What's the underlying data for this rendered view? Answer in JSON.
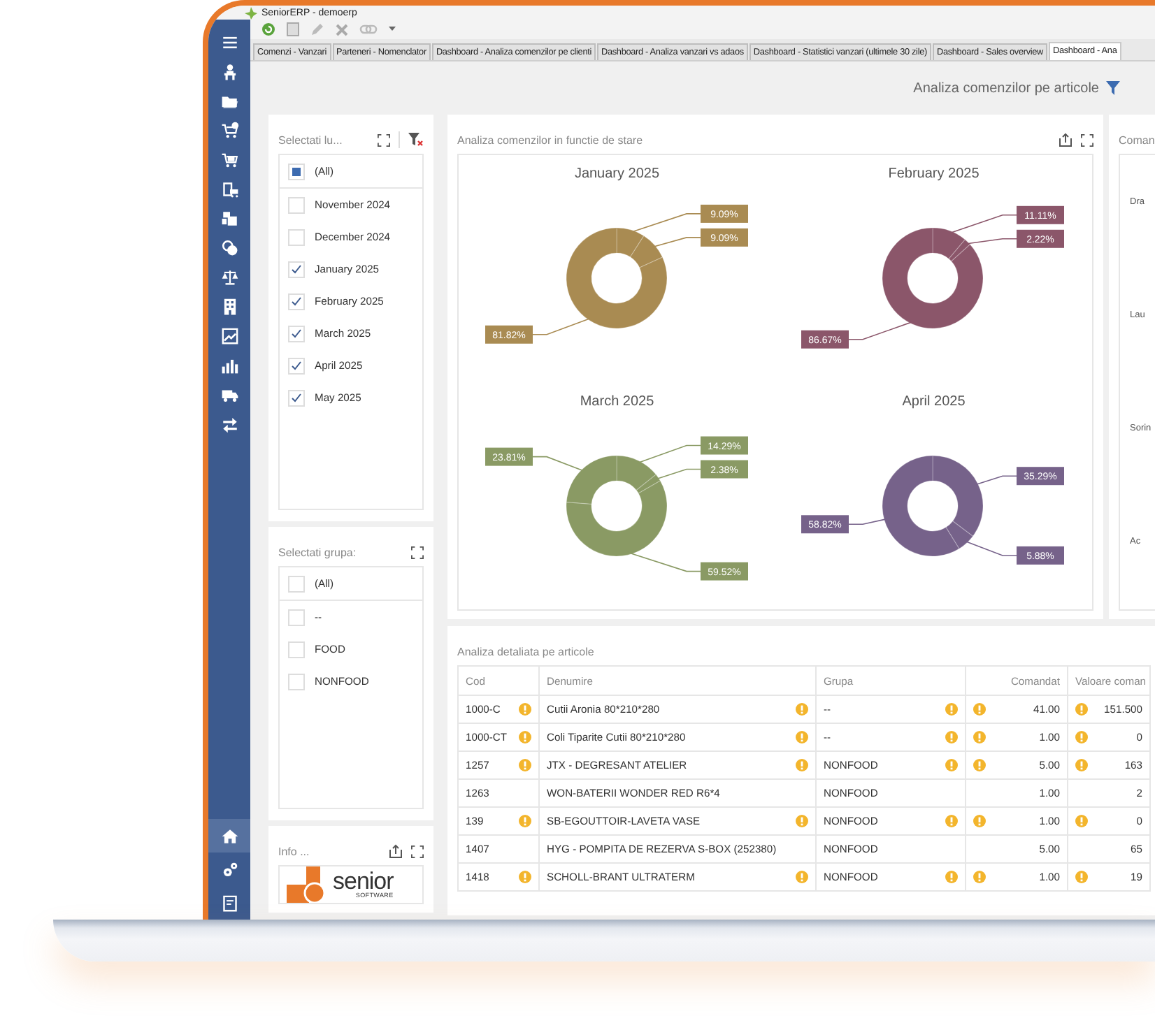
{
  "window": {
    "title": "SeniorERP - demoerp"
  },
  "toolbar": [
    {
      "kind": "refresh"
    },
    {
      "kind": "document"
    },
    {
      "kind": "pencil"
    },
    {
      "kind": "delete"
    },
    {
      "kind": "link"
    },
    {
      "kind": "caret"
    }
  ],
  "sidebar": {
    "top_items": [
      {
        "kind": "menu",
        "selected": false
      },
      {
        "kind": "person",
        "selected": false
      },
      {
        "kind": "folder",
        "selected": false
      },
      {
        "kind": "cart-plus",
        "selected": false
      },
      {
        "kind": "cart",
        "selected": false
      },
      {
        "kind": "clipboard",
        "selected": false
      },
      {
        "kind": "boxes",
        "selected": false
      },
      {
        "kind": "coins",
        "selected": false
      },
      {
        "kind": "scales",
        "selected": false
      },
      {
        "kind": "building",
        "selected": false
      },
      {
        "kind": "line-chart",
        "selected": false
      },
      {
        "kind": "bar-chart",
        "selected": false
      },
      {
        "kind": "truck",
        "selected": false
      },
      {
        "kind": "arrows",
        "selected": false
      }
    ],
    "bottom_items": [
      {
        "kind": "home",
        "selected": true
      },
      {
        "kind": "gears",
        "selected": false
      },
      {
        "kind": "report",
        "selected": false
      }
    ]
  },
  "tabs": [
    {
      "label": "Comenzi - Vanzari",
      "selected": false
    },
    {
      "label": "Parteneri - Nomenclator",
      "selected": false
    },
    {
      "label": "Dashboard - Analiza comenzilor pe clienti",
      "selected": false
    },
    {
      "label": "Dashboard - Analiza vanzari vs adaos",
      "selected": false
    },
    {
      "label": "Dashboard - Statistici vanzari (ultimele 30 zile)",
      "selected": false
    },
    {
      "label": "Dashboard - Sales overview",
      "selected": false
    },
    {
      "label": "Dashboard - Ana",
      "selected": true
    }
  ],
  "header": {
    "title": "Analiza comenzilor pe articole"
  },
  "month_filter": {
    "title": "Selectati lu...",
    "items": [
      {
        "label": "(All)",
        "checked": false,
        "indeterminate": true
      },
      {
        "label": "November 2024",
        "checked": false,
        "indeterminate": false
      },
      {
        "label": "December 2024",
        "checked": false,
        "indeterminate": false
      },
      {
        "label": "January 2025",
        "checked": true,
        "indeterminate": false
      },
      {
        "label": "February 2025",
        "checked": true,
        "indeterminate": false
      },
      {
        "label": "March 2025",
        "checked": true,
        "indeterminate": false
      },
      {
        "label": "April 2025",
        "checked": true,
        "indeterminate": false
      },
      {
        "label": "May 2025",
        "checked": true,
        "indeterminate": false
      }
    ]
  },
  "group_filter": {
    "title": "Selectati grupa:",
    "items": [
      {
        "label": "(All)",
        "checked": false,
        "indeterminate": false
      },
      {
        "label": "--",
        "checked": false,
        "indeterminate": false
      },
      {
        "label": "FOOD",
        "checked": false,
        "indeterminate": false
      },
      {
        "label": "NONFOOD",
        "checked": false,
        "indeterminate": false
      }
    ]
  },
  "info_panel": {
    "title": "Info ...",
    "logo": {
      "name": "senior",
      "tagline": "SOFTWARE"
    }
  },
  "status_panel": {
    "title": "Analiza comenzilor in functie de stare",
    "charts": [
      {
        "chart_data": {
          "type": "donut",
          "title": "January 2025",
          "value_labels": [
            "9.09%",
            "9.09%",
            "81.82%"
          ],
          "series": [
            {
              "color": "#a98b52",
              "values": [
                9.09,
                9.09,
                81.82
              ]
            }
          ]
        }
      },
      {
        "chart_data": {
          "type": "donut",
          "title": "February 2025",
          "value_labels": [
            "11.11%",
            "2.22%",
            "86.67%"
          ],
          "series": [
            {
              "color": "#8b566a",
              "values": [
                11.11,
                2.22,
                86.67
              ]
            }
          ]
        }
      },
      {
        "chart_data": {
          "type": "donut",
          "title": "March 2025",
          "value_labels": [
            "14.29%",
            "2.38%",
            "59.52%",
            "23.81%"
          ],
          "series": [
            {
              "color": "#8a9a64",
              "values": [
                14.29,
                2.38,
                59.52,
                23.81
              ]
            }
          ]
        }
      },
      {
        "chart_data": {
          "type": "donut",
          "title": "April 2025",
          "value_labels": [
            "35.29%",
            "5.88%",
            "58.82%"
          ],
          "series": [
            {
              "color": "#76628a",
              "values": [
                35.29,
                5.88,
                58.82
              ]
            }
          ]
        }
      }
    ]
  },
  "side_panel": {
    "title": "Coman",
    "labels": [
      "Dra",
      "Lau",
      "Sorin",
      "Ac"
    ]
  },
  "table": {
    "title": "Analiza detaliata pe articole",
    "columns": [
      "Cod",
      "Denumire",
      "Grupa",
      "Comandat",
      "Valoare coman"
    ],
    "rows": [
      {
        "cells": [
          "1000-C",
          "Cutii Aronia 80*210*280",
          "--",
          "41.00",
          "151.500"
        ],
        "warning": true
      },
      {
        "cells": [
          "1000-CT",
          "Coli Tiparite Cutii 80*210*280",
          "--",
          "1.00",
          "0"
        ],
        "warning": true
      },
      {
        "cells": [
          "1257",
          "JTX - DEGRESANT ATELIER",
          "NONFOOD",
          "5.00",
          "163"
        ],
        "warning": true
      },
      {
        "cells": [
          "1263",
          "WON-BATERII WONDER RED R6*4",
          "NONFOOD",
          "1.00",
          "2"
        ],
        "warning": false
      },
      {
        "cells": [
          "139",
          "SB-EGOUTTOIR-LAVETA VASE",
          "NONFOOD",
          "1.00",
          "0"
        ],
        "warning": true
      },
      {
        "cells": [
          "1407",
          "HYG - POMPITA DE REZERVA S-BOX (252380)",
          "NONFOOD",
          "5.00",
          "65"
        ],
        "warning": false
      },
      {
        "cells": [
          "1418",
          "SCHOLL-BRANT ULTRATERM",
          "NONFOOD",
          "1.00",
          "19"
        ],
        "warning": true
      }
    ]
  }
}
